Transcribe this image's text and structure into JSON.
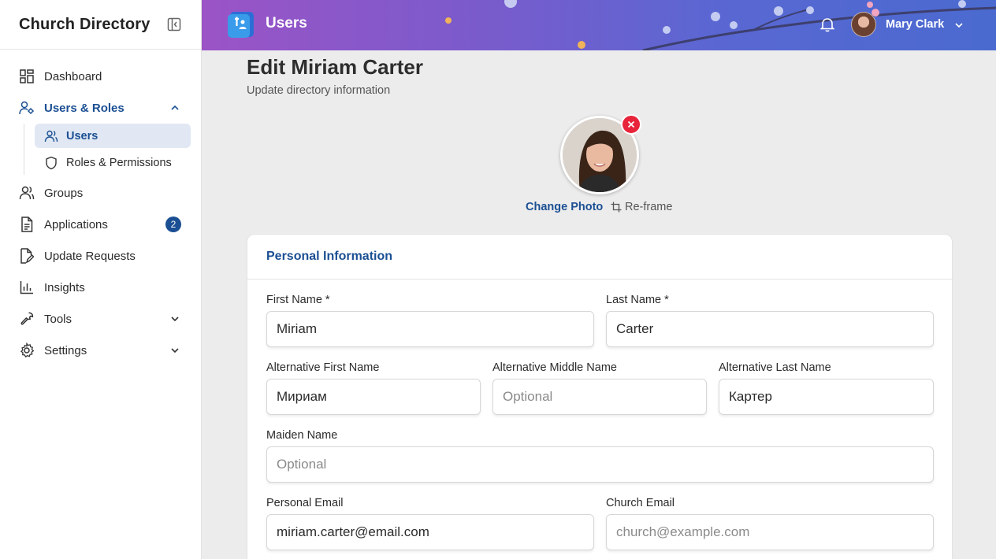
{
  "sidebar": {
    "title": "Church Directory",
    "items": [
      {
        "label": "Dashboard"
      },
      {
        "label": "Users & Roles"
      },
      {
        "label": "Groups"
      },
      {
        "label": "Applications",
        "badge": "2"
      },
      {
        "label": "Update Requests"
      },
      {
        "label": "Insights"
      },
      {
        "label": "Tools"
      },
      {
        "label": "Settings"
      }
    ],
    "subitems": [
      {
        "label": "Users"
      },
      {
        "label": "Roles & Permissions"
      }
    ]
  },
  "header": {
    "title": "Users",
    "user_name": "Mary Clark"
  },
  "page": {
    "title": "Edit Miriam Carter",
    "subtitle": "Update directory information",
    "change_photo": "Change Photo",
    "reframe": "Re-frame"
  },
  "card": {
    "title": "Personal Information",
    "fields": {
      "first_name": {
        "label": "First Name *",
        "value": "Miriam"
      },
      "last_name": {
        "label": "Last Name *",
        "value": "Carter"
      },
      "alt_first": {
        "label": "Alternative First Name",
        "value": "Мириам"
      },
      "alt_middle": {
        "label": "Alternative Middle Name",
        "placeholder": "Optional"
      },
      "alt_last": {
        "label": "Alternative Last Name",
        "value": "Картер"
      },
      "maiden": {
        "label": "Maiden Name",
        "placeholder": "Optional"
      },
      "personal_email": {
        "label": "Personal Email",
        "value": "miriam.carter@email.com"
      },
      "church_email": {
        "label": "Church Email",
        "placeholder": "church@example.com"
      }
    }
  },
  "colors": {
    "accent": "#1b4f93",
    "danger": "#e8243b"
  }
}
